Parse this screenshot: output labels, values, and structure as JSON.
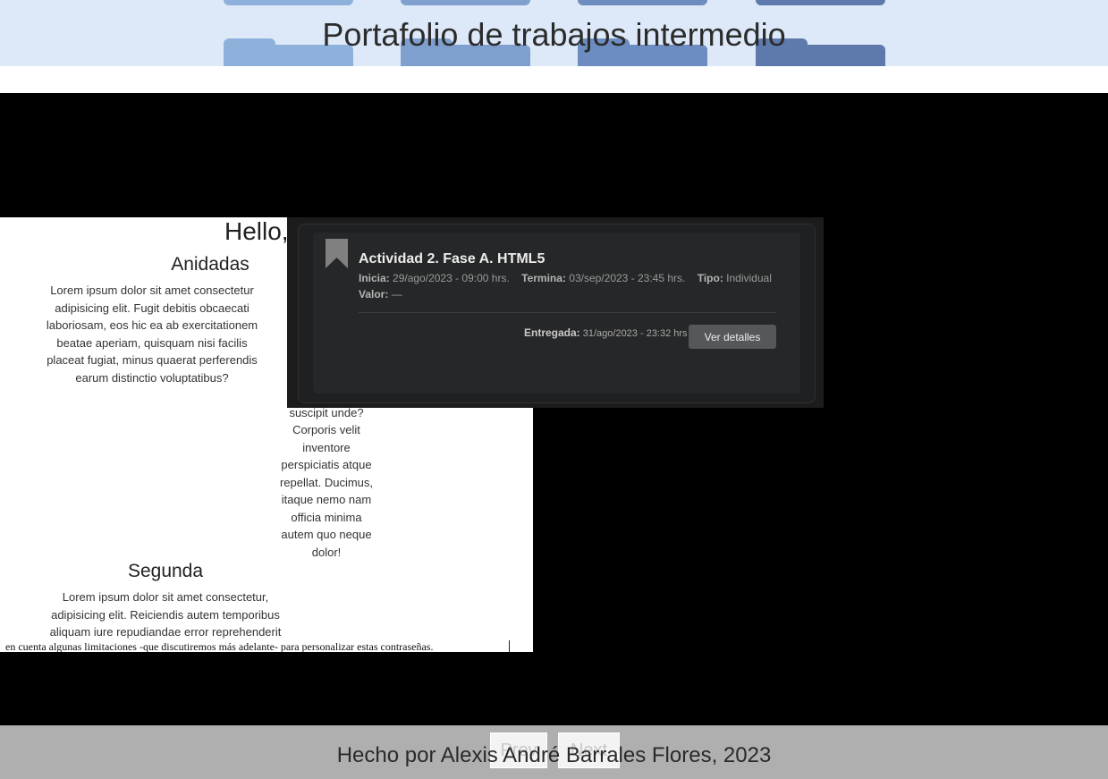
{
  "header": {
    "title": "Portafolio de trabajos intermedio",
    "background_color": "#dde9f8",
    "folder_colors": [
      "#8eb1dc",
      "#7f9fcf",
      "#6d8cc0",
      "#5e79ac"
    ]
  },
  "preview": {
    "heading": "Hello,",
    "anidadas_title": "Anidadas",
    "anidadas_text": "Lorem ipsum dolor sit amet consectetur adipisicing elit. Fugit debitis obcaecati laboriosam, eos hic ea ab exercitationem beatae aperiam, quisquam nisi facilis placeat fugiat, minus quaerat perferendis earum distinctio voluptatibus?",
    "middle_text": "Lo... r... suscipit unde? Corporis velit inventore perspiciatis atque repellat. Ducimus, itaque nemo nam officia minima autem quo neque dolor!",
    "segunda_title": "Segunda",
    "segunda_text": "Lorem ipsum dolor sit amet consectetur, adipisicing elit. Reiciendis autem temporibus aliquam iure repudiandae error reprehenderit",
    "bottom_strip": "en cuenta algunas limitaciones -que discutiremos más adelante- para personalizar estas contraseñas."
  },
  "activity_card": {
    "icon": "bookmark-icon",
    "title": "Actividad 2. Fase A. HTML5",
    "inicia_label": "Inicia:",
    "inicia_value": "29/ago/2023 - 09:00 hrs.",
    "termina_label": "Termina:",
    "termina_value": "03/sep/2023 - 23:45 hrs.",
    "tipo_label": "Tipo:",
    "tipo_value": "Individual",
    "valor_label": "Valor:",
    "valor_value": "—",
    "entregada_label": "Entregada:",
    "entregada_value": "31/ago/2023 - 23:32 hrs",
    "details_button": "Ver detalles"
  },
  "footer": {
    "prev_label": "Prev",
    "next_label": "Next",
    "credits": "Hecho por Alexis André Barrales Flores, 2023"
  }
}
